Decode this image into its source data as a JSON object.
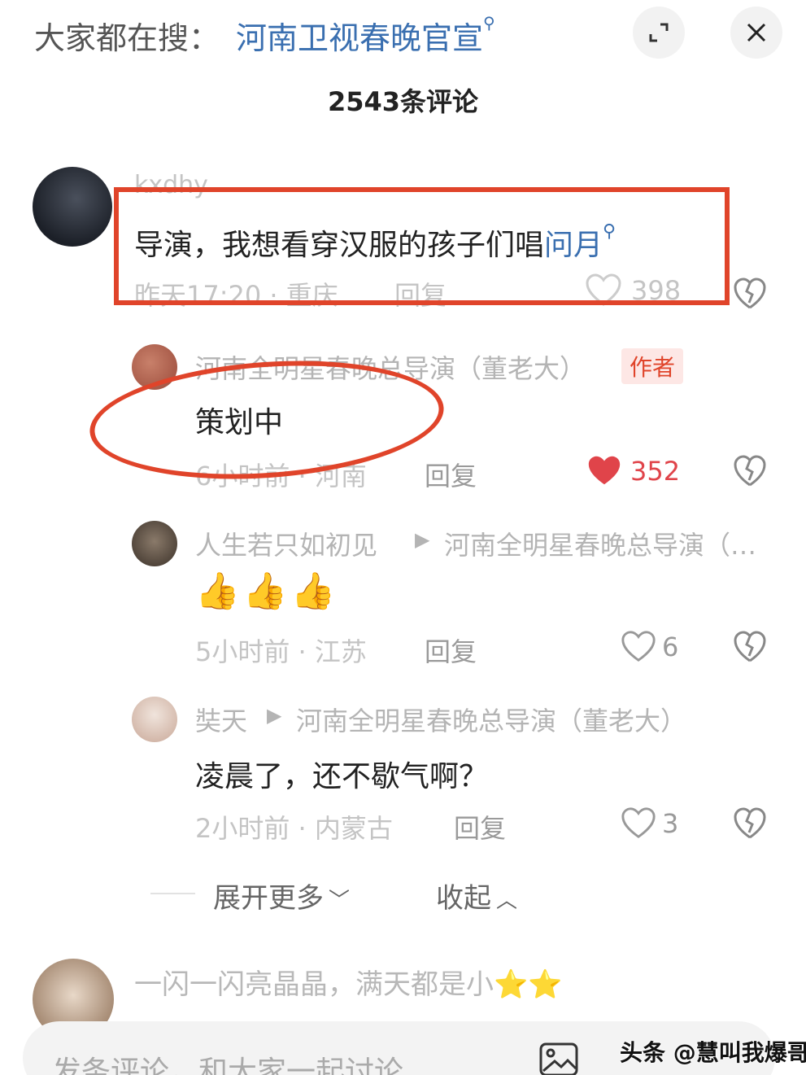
{
  "header": {
    "search_prefix": "大家都在搜：",
    "search_term": "河南卫视春晚官宣",
    "comment_count": "2543条评论"
  },
  "comments": [
    {
      "username": "kxdhy",
      "text": "导演，我想看穿汉服的孩子们唱",
      "link": "问月",
      "meta": "昨天17:20 · 重庆",
      "reply": "回复",
      "likes": "398"
    }
  ],
  "replies": [
    {
      "username": "河南全明星春晚总导演（董老大）",
      "badge": "作者",
      "text": "策划中",
      "meta": "6小时前 · 河南",
      "reply": "回复",
      "likes": "352",
      "liked_color": "#e0444a"
    },
    {
      "username": "人生若只如初见",
      "target": "河南全明星春晚总导演（…",
      "text": "👍👍👍",
      "meta": "5小时前 · 江苏",
      "reply": "回复",
      "likes": "6"
    },
    {
      "username": "奘天",
      "target": "河南全明星春晚总导演（董老大）",
      "text": "凌晨了，还不歇气啊？",
      "meta": "2小时前 · 内蒙古",
      "reply": "回复",
      "likes": "3"
    }
  ],
  "controls": {
    "expand_more": "展开更多",
    "collapse": "收起"
  },
  "next_comment": {
    "text": "一闪一闪亮晶晶，满天都是小⭐⭐"
  },
  "bottom": {
    "placeholder": "发条评论，和大家一起讨论",
    "watermark": "头条 @慧叫我爆哥"
  },
  "colors": {
    "accent_link": "#3a6fb0",
    "annotation_red": "#e0442a"
  }
}
